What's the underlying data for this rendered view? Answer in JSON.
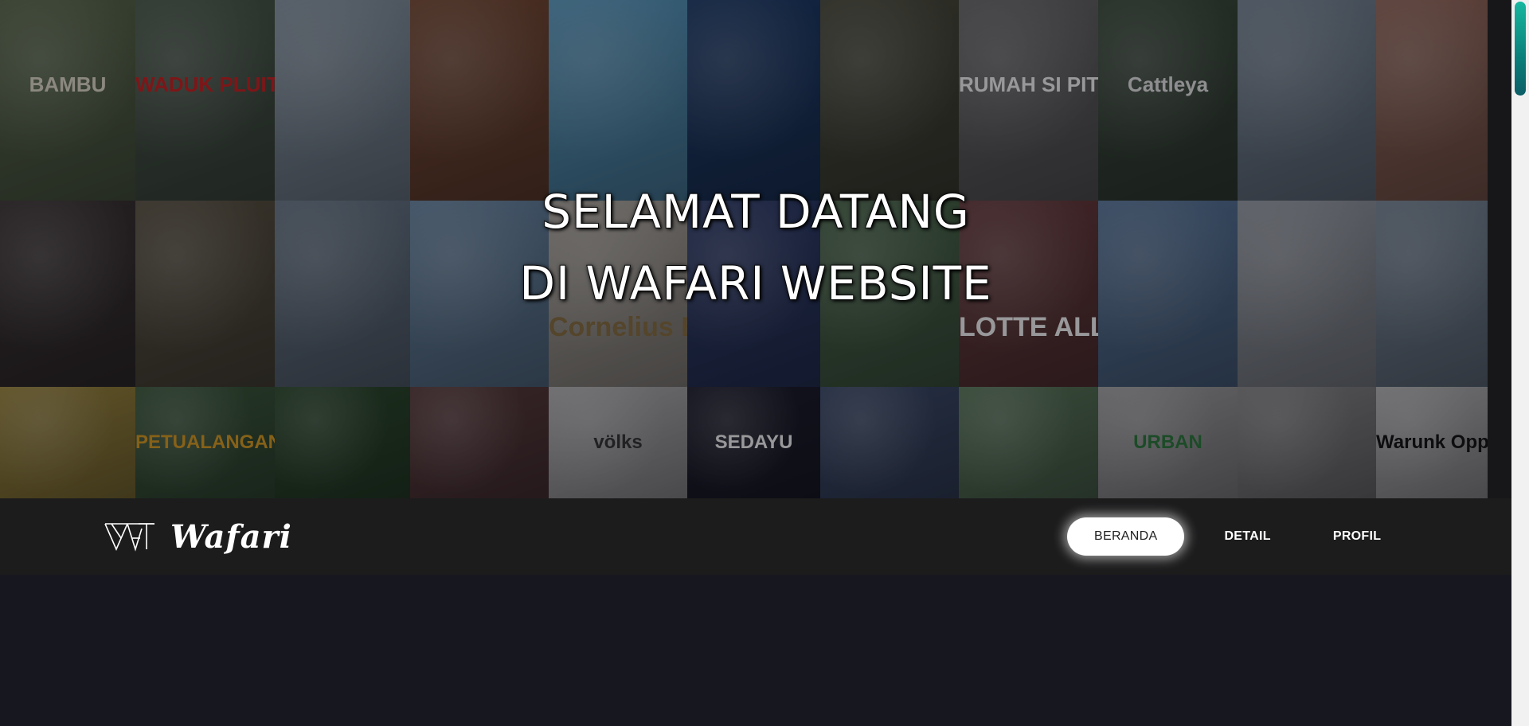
{
  "hero": {
    "title_line1": "SELAMAT DATANG",
    "title_line2": "DI WAFARI WEBSITE",
    "tiles": [
      {
        "bg": "#5a6a4a",
        "caption": "BAMBU",
        "color": "#e8e4d0"
      },
      {
        "bg": "#4a5a4a",
        "caption": "WADUK PLUIT",
        "color": "#d02020"
      },
      {
        "bg": "#8a9aa8",
        "caption": "",
        "color": "#ffffff"
      },
      {
        "bg": "#7a4a32",
        "caption": "",
        "color": "#ffffff"
      },
      {
        "bg": "#5aa0c8",
        "caption": "",
        "color": "#ffffff"
      },
      {
        "bg": "#1a3a6a",
        "caption": "",
        "color": "#ffffff"
      },
      {
        "bg": "#4a4a3a",
        "caption": "",
        "color": "#ffffff"
      },
      {
        "bg": "#6a6a6a",
        "caption": "RUMAH SI PITUNG",
        "color": "#ffffff"
      },
      {
        "bg": "#3a4a3a",
        "caption": "Cattleya",
        "color": "#eeeeee"
      },
      {
        "bg": "#7a8a9a",
        "caption": "",
        "color": "#ffffff"
      },
      {
        "bg": "#9a6a5a",
        "caption": "",
        "color": "#ffffff"
      },
      {
        "bg": "#3a3232",
        "caption": "",
        "color": "#ffffff"
      },
      {
        "bg": "#5a5240",
        "caption": "",
        "color": "#ffffff"
      },
      {
        "bg": "#6a7a8a",
        "caption": "",
        "color": "#ffffff"
      },
      {
        "bg": "#6a8aa8",
        "caption": "",
        "color": "#ffffff"
      },
      {
        "bg": "#b0aaa0",
        "caption": "Cornelius Bakes",
        "color": "#8a7040"
      },
      {
        "bg": "#2a3a6a",
        "caption": "",
        "color": "#ffffff"
      },
      {
        "bg": "#4a6a4a",
        "caption": "",
        "color": "#ffffff"
      },
      {
        "bg": "#6a3a3a",
        "caption": "LOTTE ALLEY",
        "color": "#ffffff"
      },
      {
        "bg": "#5a7aa0",
        "caption": "",
        "color": "#ffffff"
      },
      {
        "bg": "#9aa0a8",
        "caption": "",
        "color": "#ffffff"
      },
      {
        "bg": "#7a8a9a",
        "caption": "",
        "color": "#ffffff"
      },
      {
        "bg": "#a08a3a",
        "caption": "",
        "color": "#ffffff"
      },
      {
        "bg": "#3a5a3a",
        "caption": "PETUALANGAN DINOSAURUS",
        "color": "#e0a020"
      },
      {
        "bg": "#2a4a2a",
        "caption": "",
        "color": "#ffffff"
      },
      {
        "bg": "#5a3a3a",
        "caption": "",
        "color": "#ffffff"
      },
      {
        "bg": "#b8b8b8",
        "caption": "völks",
        "color": "#333333"
      },
      {
        "bg": "#1a1a2a",
        "caption": "SEDAYU",
        "color": "#ffffff"
      },
      {
        "bg": "#3a4a6a",
        "caption": "",
        "color": "#ffffff"
      },
      {
        "bg": "#5a7a5a",
        "caption": "",
        "color": "#ffffff"
      },
      {
        "bg": "#a8a8a8",
        "caption": "URBAN",
        "color": "#2a7a3a"
      },
      {
        "bg": "#8a8a8a",
        "caption": "",
        "color": "#ffffff"
      },
      {
        "bg": "#bababa",
        "caption": "Warunk Oppa",
        "color": "#111111"
      }
    ]
  },
  "navbar": {
    "brand": "Wafari",
    "items": [
      {
        "label": "BERANDA"
      },
      {
        "label": "DETAIL"
      },
      {
        "label": "PROFIL"
      }
    ]
  },
  "colors": {
    "page_bg": "#171720",
    "navbar_bg": "#1c1c1d",
    "scroll_thumb": "#0a7f7a"
  }
}
